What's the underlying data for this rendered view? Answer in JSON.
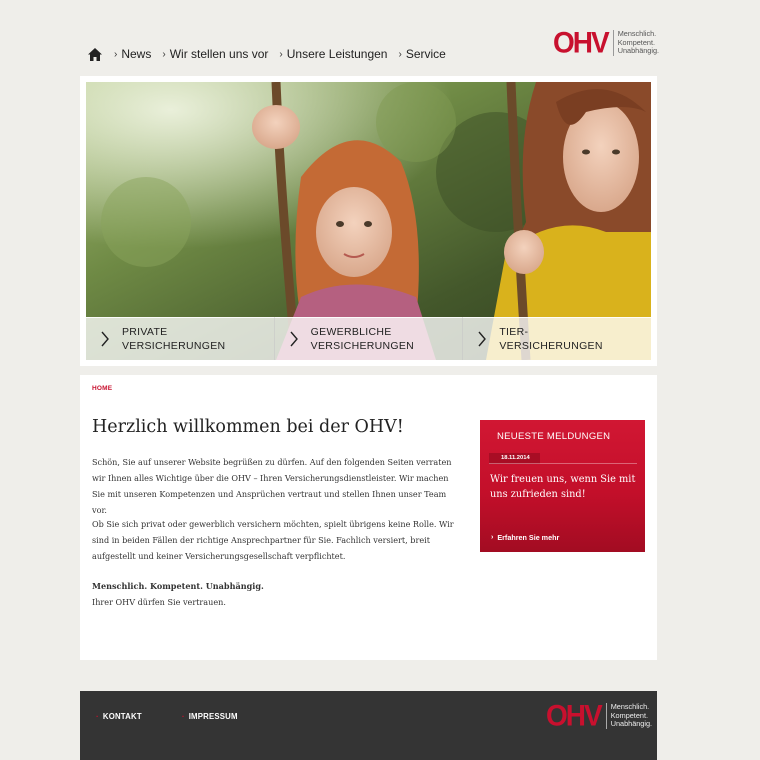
{
  "brand": {
    "logo_text": "OHV",
    "tagline": [
      "Menschlich.",
      "Kompetent.",
      "Unabhängig."
    ],
    "accent_color": "#c8102e"
  },
  "nav": {
    "home_icon": "home-icon",
    "items": [
      {
        "label": "News"
      },
      {
        "label": "Wir stellen uns vor"
      },
      {
        "label": "Unsere Leistungen"
      },
      {
        "label": "Service"
      }
    ]
  },
  "hero": {
    "tiles": [
      {
        "line1": "PRIVATE",
        "line2": "VERSICHERUNGEN"
      },
      {
        "line1": "GEWERBLICHE",
        "line2": "VERSICHERUNGEN"
      },
      {
        "line1": "TIER-",
        "line2": "VERSICHERUNGEN"
      }
    ]
  },
  "main": {
    "breadcrumb": "HOME",
    "title": "Herzlich willkommen bei der OHV!",
    "paragraph1": "Schön, Sie auf unserer Website begrüßen zu dürfen. Auf den folgenden Seiten verraten wir Ihnen alles Wichtige über die OHV – Ihren Versicherungsdienstleister. Wir machen Sie mit unseren Kompetenzen und Ansprüchen vertraut und stellen Ihnen unser Team vor.",
    "paragraph2": "Ob Sie sich privat oder gewerblich versichern möchten, spielt übrigens keine Rolle. Wir sind in beiden Fällen der richtige Ansprechpartner für Sie. Fachlich versiert, breit aufgestellt und keiner Versicherungsgesellschaft verpflichtet.",
    "motto": "Menschlich. Kompetent. Unabhängig.",
    "closing": "Ihrer OHV dürfen Sie vertrauen."
  },
  "news": {
    "heading": "NEUESTE MELDUNGEN",
    "date": "18.11.2014",
    "headline": "Wir freuen uns, wenn Sie mit uns zufrieden sind!",
    "more_label": "Erfahren Sie mehr"
  },
  "footer": {
    "links": [
      {
        "label": "KONTAKT"
      },
      {
        "label": "IMPRESSUM"
      }
    ]
  }
}
